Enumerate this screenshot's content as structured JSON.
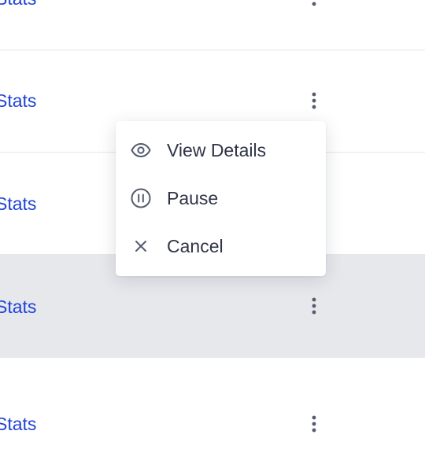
{
  "rows": [
    {
      "link_label": "Stats"
    },
    {
      "link_label": "Stats"
    },
    {
      "link_label": "Stats"
    },
    {
      "link_label": "Stats"
    },
    {
      "link_label": "Stats"
    }
  ],
  "row_states": {
    "highlighted_row": 4
  },
  "action_menu": {
    "items": [
      {
        "label": "View Details",
        "icon": "eye-icon"
      },
      {
        "label": "Pause",
        "icon": "pause-circle-icon"
      },
      {
        "label": "Cancel",
        "icon": "close-icon"
      }
    ]
  },
  "colors": {
    "link": "#1f43d7",
    "menu_text": "#2f3447",
    "icon": "#555b6e",
    "row_highlight": "#e7e8ec",
    "divider": "#e6e7eb"
  }
}
